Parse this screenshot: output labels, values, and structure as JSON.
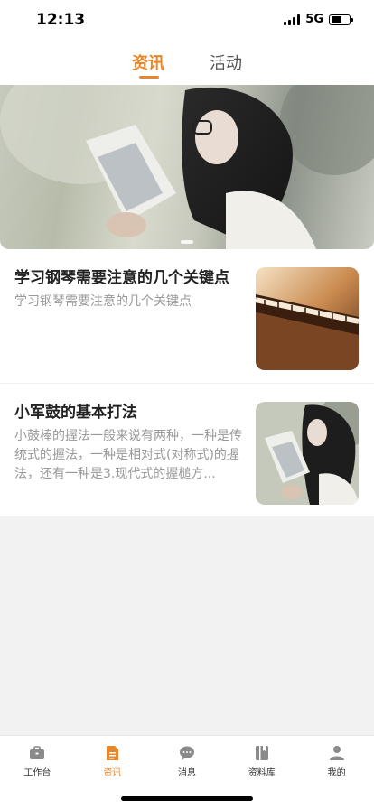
{
  "status_bar": {
    "time": "12:13",
    "network": "5G",
    "battery_level": 0.6
  },
  "top_tabs": [
    {
      "label": "资讯",
      "active": true
    },
    {
      "label": "活动",
      "active": false
    }
  ],
  "banner": {
    "image": "girl-reading-book",
    "slide_index": 1
  },
  "news": [
    {
      "title": "学习钢琴需要注意的几个关键点",
      "summary": "学习钢琴需要注意的几个关键点",
      "thumbnail": "piano-keys"
    },
    {
      "title": "小军鼓的基本打法",
      "summary": "小鼓棒的握法一般来说有两种，一种是传统式的握法，一种是相对式(对称式)的握法，还有一种是3.现代式的握槌方...",
      "thumbnail": "girl-reading-book"
    }
  ],
  "tab_bar": [
    {
      "label": "工作台",
      "icon": "briefcase-icon",
      "active": false
    },
    {
      "label": "资讯",
      "icon": "document-icon",
      "active": true
    },
    {
      "label": "消息",
      "icon": "chat-icon",
      "active": false
    },
    {
      "label": "资料库",
      "icon": "book-icon",
      "active": false
    },
    {
      "label": "我的",
      "icon": "person-icon",
      "active": false
    }
  ],
  "colors": {
    "accent": "#e8862a",
    "text": "#222222",
    "muted": "#999999",
    "background": "#f2f2f2"
  }
}
